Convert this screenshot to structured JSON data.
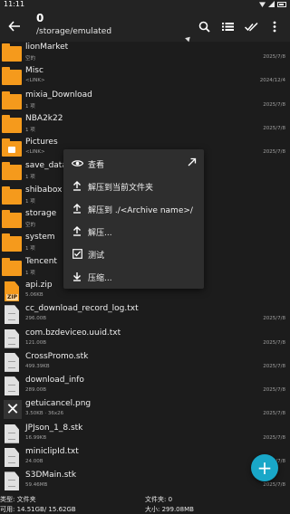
{
  "statusbar": {
    "time": "11:11"
  },
  "toolbar": {
    "count": "0",
    "path": "/storage/emulated"
  },
  "files": [
    {
      "name": "lionMarket",
      "sub": "空的",
      "date": "2025/7/8",
      "icon": "folder"
    },
    {
      "name": "Misc",
      "sub": "<LINK>",
      "date": "2024/12/4",
      "icon": "folder"
    },
    {
      "name": "mixia_Download",
      "sub": "1 项",
      "date": "2025/7/8",
      "icon": "folder"
    },
    {
      "name": "NBA2k22",
      "sub": "1 项",
      "date": "2025/7/8",
      "icon": "folder"
    },
    {
      "name": "Pictures",
      "sub": "<LINK>",
      "date": "2025/7/8",
      "icon": "folder-image"
    },
    {
      "name": "save_data",
      "sub": "1 项",
      "date": "",
      "icon": "folder"
    },
    {
      "name": "shibabox",
      "sub": "1 项",
      "date": "",
      "icon": "folder"
    },
    {
      "name": "storage",
      "sub": "空的",
      "date": "",
      "icon": "folder"
    },
    {
      "name": "system",
      "sub": "1 项",
      "date": "",
      "icon": "folder"
    },
    {
      "name": "Tencent",
      "sub": "1 项",
      "date": "",
      "icon": "folder"
    },
    {
      "name": "api.zip",
      "sub": "5.06KB",
      "date": "",
      "icon": "zip"
    },
    {
      "name": "cc_download_record_log.txt",
      "sub": "296.00B",
      "date": "2025/7/8",
      "icon": "doc"
    },
    {
      "name": "com.bzdeviceo.uuid.txt",
      "sub": "121.00B",
      "date": "2025/7/8",
      "icon": "doc"
    },
    {
      "name": "CrossPromo.stk",
      "sub": "499.39KB",
      "date": "2025/7/8",
      "icon": "doc"
    },
    {
      "name": "download_info",
      "sub": "289.00B",
      "date": "2025/7/8",
      "icon": "doc"
    },
    {
      "name": "getuicancel.png",
      "sub": "3.50KB  ·  36x26",
      "date": "2025/7/8",
      "icon": "image-broken"
    },
    {
      "name": "JPJson_1_8.stk",
      "sub": "16.99KB",
      "date": "2025/7/8",
      "icon": "doc"
    },
    {
      "name": "miniclipId.txt",
      "sub": "24.00B",
      "date": "2025/7/8",
      "icon": "doc"
    },
    {
      "name": "S3DMain.stk",
      "sub": "59.46MB",
      "date": "2025/7/8",
      "icon": "doc"
    }
  ],
  "context_menu": {
    "items": [
      {
        "label": "查看",
        "icon": "eye-icon"
      },
      {
        "label": "解压到当前文件夹",
        "icon": "upload-icon"
      },
      {
        "label": "解压到 ./<Archive name>/",
        "icon": "upload-icon"
      },
      {
        "label": "解压...",
        "icon": "upload-icon"
      },
      {
        "label": "测试",
        "icon": "checkbox-icon"
      },
      {
        "label": "压缩...",
        "icon": "download-icon"
      }
    ]
  },
  "bottom": {
    "type_label": "类型: 文件夹",
    "avail_label": "可用: 14.51GB/ 15.62GB",
    "folders_label": "文件夹: 0",
    "size_label": "大小: 299.08MB"
  },
  "colors": {
    "accent": "#19a7c8",
    "folder": "#f59a1c",
    "background": "#1c1c1c"
  }
}
